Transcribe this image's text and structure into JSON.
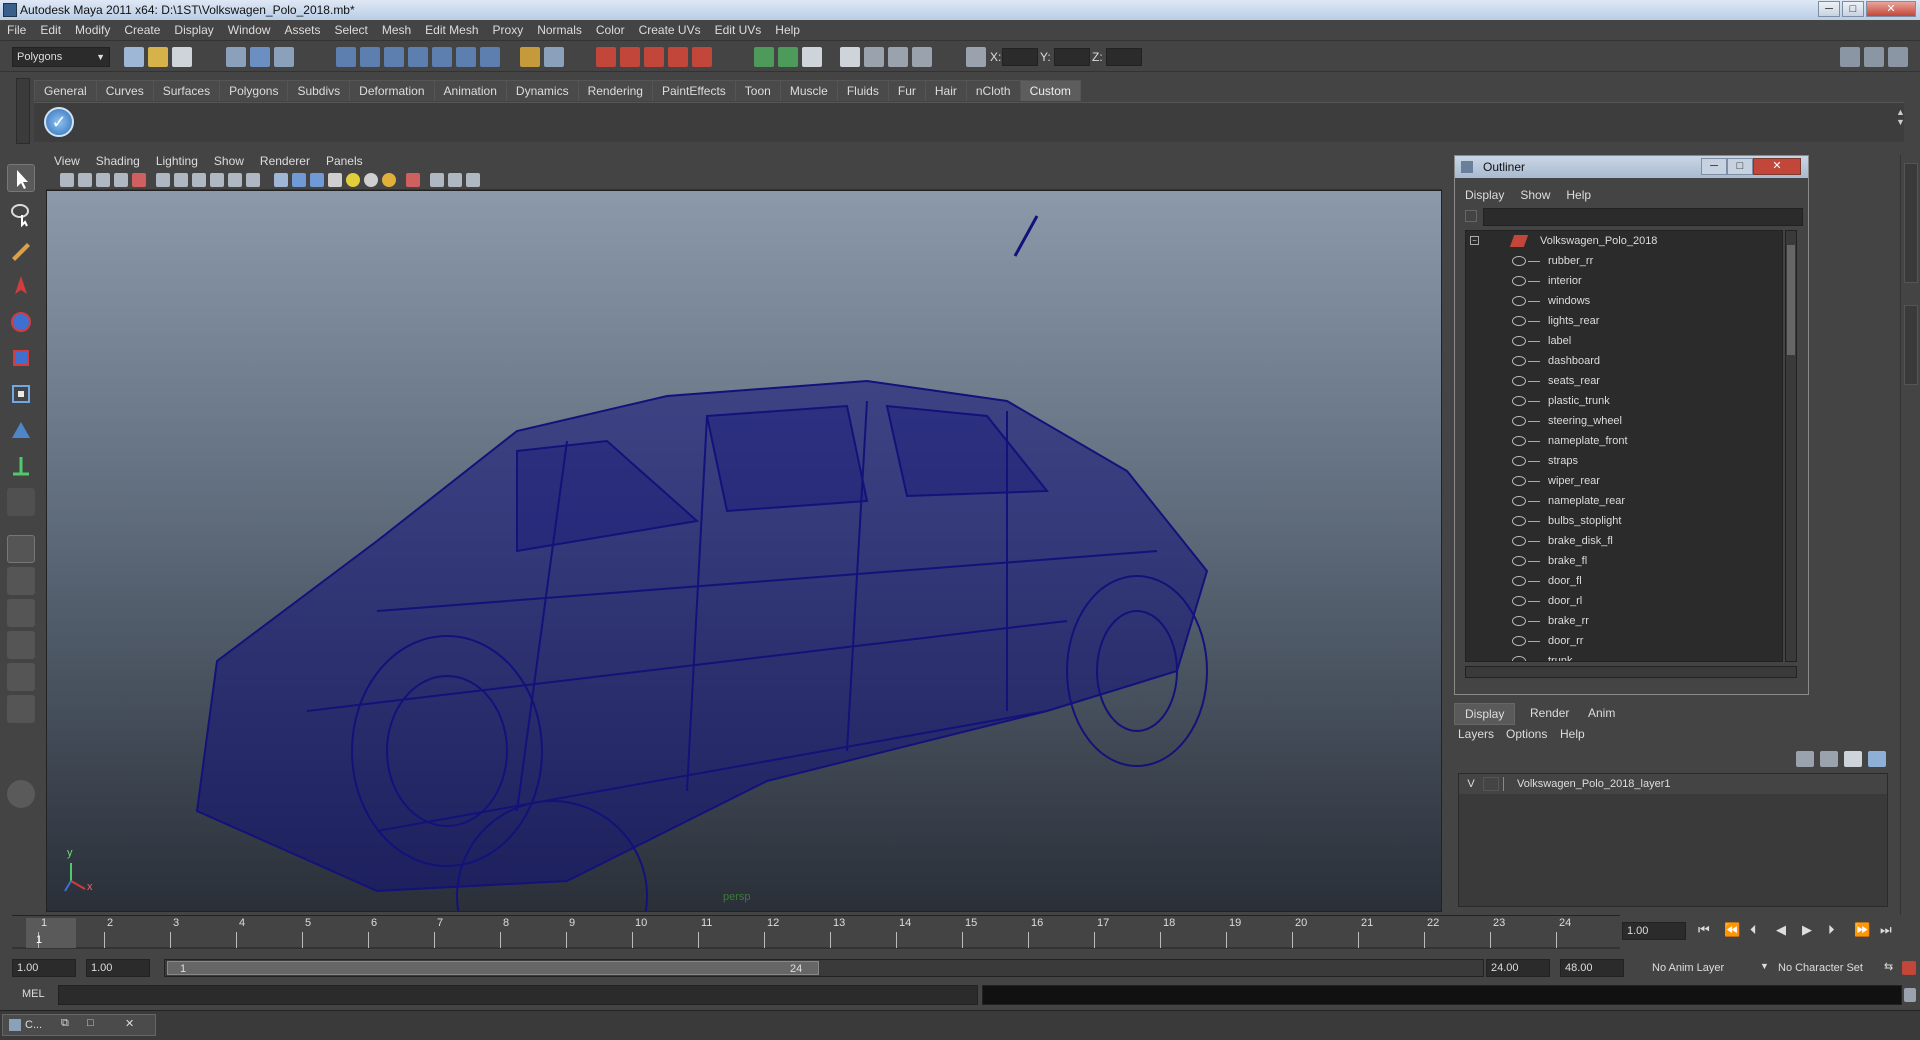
{
  "window": {
    "title": "Autodesk Maya 2011 x64: D:\\1ST\\Volkswagen_Polo_2018.mb*",
    "min_label": "─",
    "max_label": "□",
    "close_label": "✕"
  },
  "menubar": [
    "File",
    "Edit",
    "Modify",
    "Create",
    "Display",
    "Window",
    "Assets",
    "Select",
    "Mesh",
    "Edit Mesh",
    "Proxy",
    "Normals",
    "Color",
    "Create UVs",
    "Edit UVs",
    "Help"
  ],
  "statusline": {
    "mode": "Polygons",
    "x_label": "X:",
    "y_label": "Y:",
    "z_label": "Z:"
  },
  "shelf_tabs": [
    "General",
    "Curves",
    "Surfaces",
    "Polygons",
    "Subdivs",
    "Deformation",
    "Animation",
    "Dynamics",
    "Rendering",
    "PaintEffects",
    "Toon",
    "Muscle",
    "Fluids",
    "Fur",
    "Hair",
    "nCloth",
    "Custom"
  ],
  "active_shelf_tab": "Custom",
  "viewport": {
    "menu": [
      "View",
      "Shading",
      "Lighting",
      "Show",
      "Renderer",
      "Panels"
    ],
    "camera_label": "persp",
    "axis_x": "x",
    "axis_y": "y",
    "wire_color": "#12127a"
  },
  "outliner": {
    "title": "Outliner",
    "menu": [
      "Display",
      "Show",
      "Help"
    ],
    "root": "Volkswagen_Polo_2018",
    "items": [
      "rubber_rr",
      "interior",
      "windows",
      "lights_rear",
      "label",
      "dashboard",
      "seats_rear",
      "plastic_trunk",
      "steering_wheel",
      "nameplate_front",
      "straps",
      "wiper_rear",
      "nameplate_rear",
      "bulbs_stoplight",
      "brake_disk_fl",
      "brake_fl",
      "door_fl",
      "door_rl",
      "brake_rr",
      "door_rr",
      "trunk"
    ]
  },
  "layers": {
    "tabs": [
      "Display",
      "Render",
      "Anim"
    ],
    "menu": [
      "Layers",
      "Options",
      "Help"
    ],
    "visible_flag": "V",
    "layer_name": "Volkswagen_Polo_2018_layer1"
  },
  "timeline": {
    "ticks": [
      "1",
      "2",
      "3",
      "4",
      "5",
      "6",
      "7",
      "8",
      "9",
      "10",
      "11",
      "12",
      "13",
      "14",
      "15",
      "16",
      "17",
      "18",
      "19",
      "20",
      "21",
      "22",
      "23",
      "24"
    ],
    "current_frame_marker": "1",
    "current_time": "1.00"
  },
  "range": {
    "start": "1.00",
    "anim_start": "1.00",
    "slider_start": "1",
    "slider_end": "24",
    "end": "24.00",
    "anim_end": "48.00",
    "anim_layer": "No Anim Layer",
    "character_set": "No Character Set"
  },
  "cmd": {
    "label": "MEL"
  },
  "taskbar": {
    "item": "C..."
  }
}
